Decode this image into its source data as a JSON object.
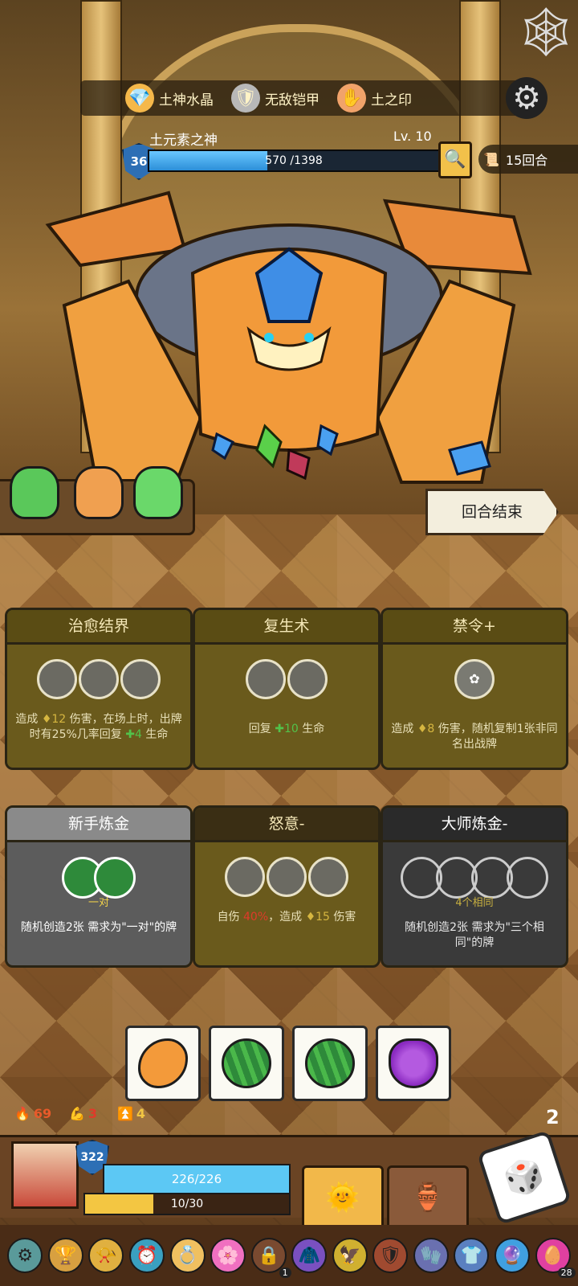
{
  "top_relics": [
    {
      "name": "土神水晶",
      "icon": "crystal-icon"
    },
    {
      "name": "无敌铠甲",
      "icon": "armor-icon"
    },
    {
      "name": "土之印",
      "icon": "seal-icon"
    }
  ],
  "boss": {
    "name": "土元素之神",
    "level": "Lv. 10",
    "shield": "36",
    "hp_text": "570 /1398",
    "hp_current": 570,
    "hp_max": 1398
  },
  "rounds": "15回合",
  "end_turn": "回合结束",
  "cards_row1": [
    {
      "title": "治愈结界",
      "slots": 3,
      "desc_parts": [
        "造成 ",
        "♦12",
        " 伤害，在场上时，出牌时有25%几率回复 ",
        "✚4",
        " 生命"
      ]
    },
    {
      "title": "复生术",
      "slots": 2,
      "desc_parts": [
        "回复 ",
        "✚10",
        " 生命"
      ]
    },
    {
      "title": "禁令+",
      "slots": 1,
      "desc_parts": [
        "造成 ",
        "♦8",
        " 伤害，随机复制1张非同名出战牌"
      ]
    }
  ],
  "cards_row2": [
    {
      "title": "新手炼金",
      "cond": "一对",
      "desc": "随机创造2张 需求为\"一对\"的牌"
    },
    {
      "title": "怒意-",
      "self_dmg": "自伤 ",
      "self_pct": "40%",
      "mid": "，造成 ",
      "dmg": "♦15",
      "tail": " 伤害"
    },
    {
      "title": "大师炼金-",
      "cond": "4个相同",
      "desc": "随机创造2张 需求为\"三个相同\"的牌"
    }
  ],
  "dice": [
    "orange-mango",
    "watermelon",
    "watermelon",
    "grapes"
  ],
  "stats": {
    "fire": "69",
    "red": "3",
    "gold": "4",
    "rerolls": "2"
  },
  "player": {
    "shield": "322",
    "hp_text": "226/226",
    "energy_text": "10/30",
    "energy_current": 10,
    "energy_max": 30
  },
  "relic_bar_badges": {
    "lock_count": "1",
    "last_count": "28"
  },
  "colors": {
    "hp_blue": "#5cc8f4",
    "energy_yellow": "#f3c642",
    "boss_hp": "#2c8fd8"
  }
}
